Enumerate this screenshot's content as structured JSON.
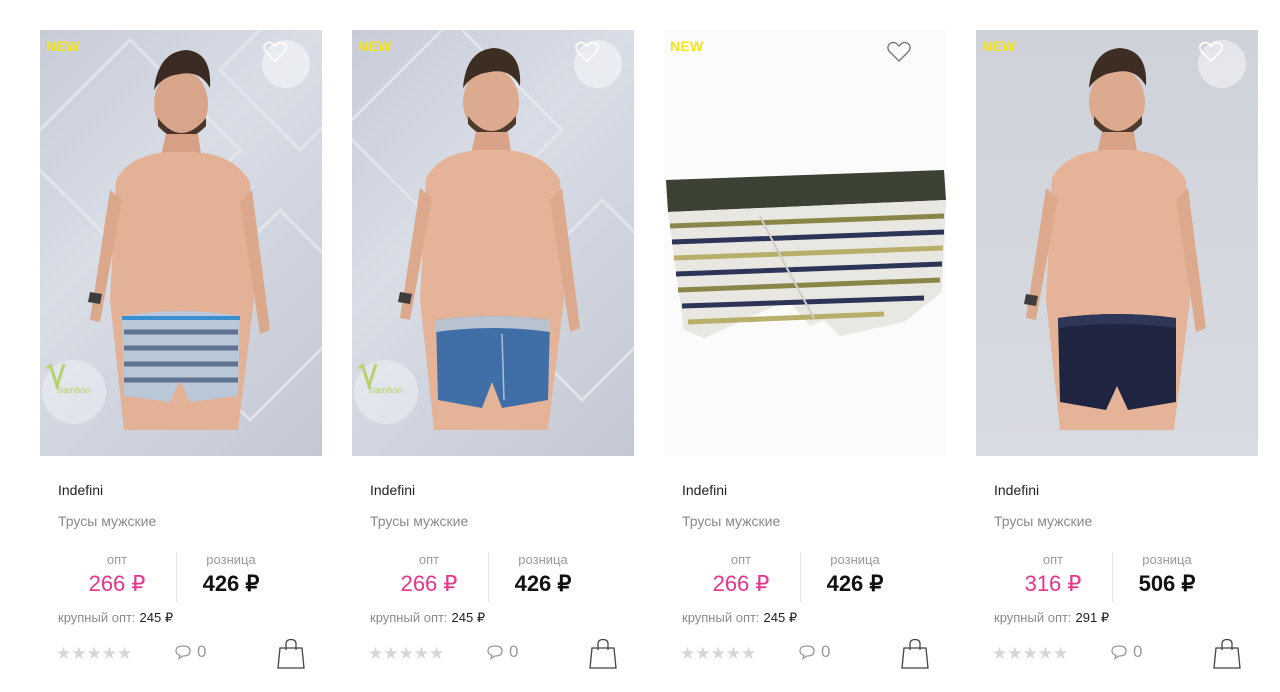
{
  "badge_color": "#f5e416",
  "accent_color": "#e8348a",
  "products": [
    {
      "badge": "NEW",
      "brand": "Indefini",
      "category": "Трусы мужские",
      "opt_label": "опт",
      "retail_label": "розница",
      "opt_price": "266 ₽",
      "retail_price": "426 ₽",
      "bulk_label": "крупный опт:",
      "bulk_price": "245 ₽",
      "rating_stars": "★★★★★",
      "comments": "0",
      "eco_label": "bamboo",
      "image": "model-grey-white-striped-trunks"
    },
    {
      "badge": "NEW",
      "brand": "Indefini",
      "category": "Трусы мужские",
      "opt_label": "опт",
      "retail_label": "розница",
      "opt_price": "266 ₽",
      "retail_price": "426 ₽",
      "bulk_label": "крупный опт:",
      "bulk_price": "245 ₽",
      "rating_stars": "★★★★★",
      "comments": "0",
      "eco_label": "bamboo",
      "image": "model-blue-trunks"
    },
    {
      "badge": "NEW",
      "brand": "Indefini",
      "category": "Трусы мужские",
      "opt_label": "опт",
      "retail_label": "розница",
      "opt_price": "266 ₽",
      "retail_price": "426 ₽",
      "bulk_label": "крупный опт:",
      "bulk_price": "245 ₽",
      "rating_stars": "★★★★★",
      "comments": "0",
      "image": "striped-trunks-product-shot"
    },
    {
      "badge": "NEW",
      "brand": "Indefini",
      "category": "Трусы мужские",
      "opt_label": "опт",
      "retail_label": "розница",
      "opt_price": "316 ₽",
      "retail_price": "506 ₽",
      "bulk_label": "крупный опт:",
      "bulk_price": "291 ₽",
      "rating_stars": "★★★★★",
      "comments": "0",
      "image": "model-navy-trunks"
    }
  ]
}
